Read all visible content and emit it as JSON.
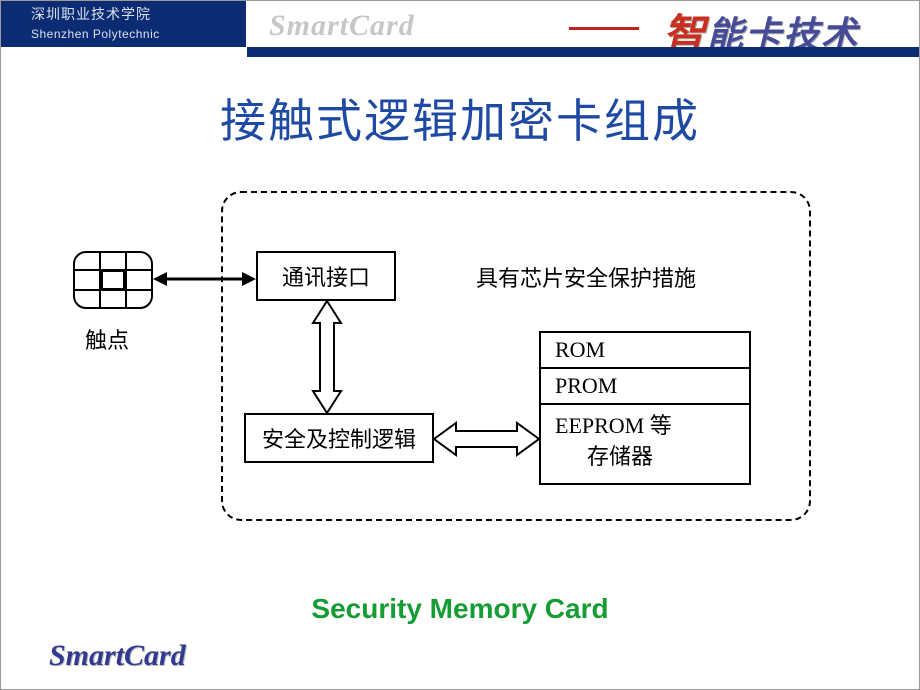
{
  "header": {
    "org_cn": "深圳职业技术学院",
    "org_en": "Shenzhen Polytechnic",
    "watermark": "SmartCard",
    "brand_prefix": "智",
    "brand_rest": "能卡技术"
  },
  "title": "接触式逻辑加密卡组成",
  "diagram": {
    "chip_label": "触点",
    "comm_interface": "通讯接口",
    "security_note": "具有芯片安全保护措施",
    "logic_box": "安全及控制逻辑",
    "memory": {
      "row1": "ROM",
      "row2": "PROM",
      "row3_line1": "EEPROM 等",
      "row3_line2": "存储器"
    }
  },
  "caption": "Security Memory Card",
  "footer_brand": "SmartCard"
}
